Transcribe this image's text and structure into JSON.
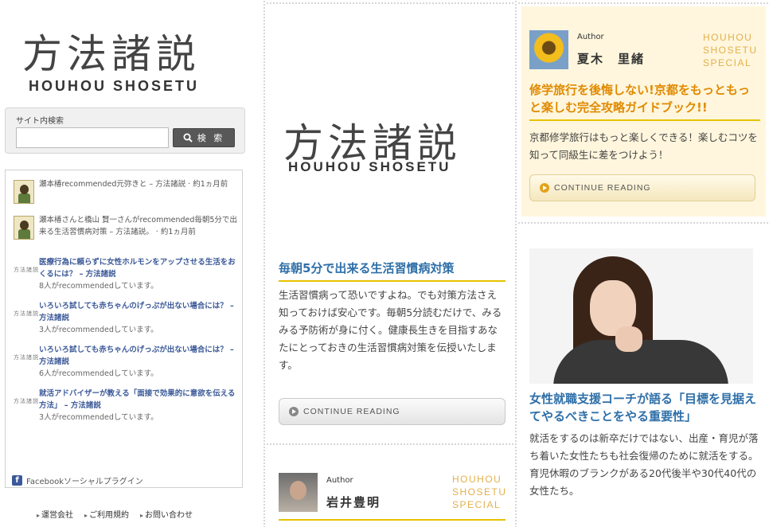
{
  "site": {
    "logo_jp": "方法諸説",
    "logo_en": "HOUHOU SHOSETU"
  },
  "search": {
    "label": "サイト内検索",
    "placeholder": "",
    "button_label": "検 索"
  },
  "facebook_plugin": {
    "items": [
      {
        "text": "瀬本椿recommended元弥きと – 方法諸説 · 約1ヵ月前",
        "meta": "",
        "thumb": "character"
      },
      {
        "text": "瀬本椿さんと橋山 賢一さんがrecommended毎朝5分で出来る生活習慣病対策 – 方法諸説。 · 約1ヵ月前",
        "meta": "",
        "thumb": "character"
      },
      {
        "text": "医療行為に頼らずに女性ホルモンをアップさせる生活をおくるには？ – 方法諸説",
        "meta": "8人がrecommendedしています。",
        "thumb": "logo"
      },
      {
        "text": "いろいろ試しても赤ちゃんのげっぷが出ない場合には？ – 方法諸説",
        "meta": "3人がrecommendedしています。",
        "thumb": "logo"
      },
      {
        "text": "いろいろ試しても赤ちゃんのげっぷが出ない場合には？ – 方法諸説",
        "meta": "6人がrecommendedしています。",
        "thumb": "logo"
      },
      {
        "text": "就活アドバイザーが教える「面接で効果的に意欲を伝える方法」 – 方法諸説",
        "meta": "3人がrecommendedしています。",
        "thumb": "logo"
      }
    ],
    "thumb_logo_text": "方法諸説",
    "footer_icon": "f",
    "footer_label": "Facebookソーシャルプラグイン"
  },
  "footer_links": [
    "運営会社",
    "ご利用規約",
    "お問い合わせ"
  ],
  "middle": {
    "article": {
      "title": "毎朝5分で出来る生活習慣病対策",
      "body": "生活習慣病って恐いですよね。でも対策方法さえ知っておけば安心です。毎朝5分読むだけで、みるみる予防術が身に付く。健康長生きを目指すあなたにとっておきの生活習慣病対策を伝授いたします。",
      "read_label": "CONTINUE READING"
    },
    "author": {
      "label": "Author",
      "name": "岩井豊明",
      "special_lines": [
        "HOUHOU",
        "SHOSETU",
        "SPECIAL"
      ]
    }
  },
  "right": {
    "author": {
      "label": "Author",
      "name": "夏木　里緒",
      "special_lines": [
        "HOUHOU",
        "SHOSETU",
        "SPECIAL"
      ]
    },
    "article": {
      "title": "修学旅行を後悔しない!京都をもっともっと楽しむ完全攻略ガイドブック!!",
      "body": "京都修学旅行はもっと楽しくできる！楽しむコツを知って同級生に差をつけよう！",
      "read_label": "CONTINUE READING"
    },
    "article2": {
      "title": "女性就職支援コーチが語る「目標を見据えてやるべきことをやる重要性」",
      "body": "就活をするのは新卒だけではない、出産・育児が落ち着いた女性たちも社会復帰のために就活をする。育児休暇のブランクがある20代後半や30代40代の女性たち。"
    }
  },
  "colors": {
    "accent_blue": "#2e6fa8",
    "accent_orange": "#e08a00",
    "accent_gold": "#e6c200",
    "special_tag": "#e3b04c",
    "highlight_bg": "#fff6dd",
    "facebook_blue": "#3b5998"
  },
  "icons": {
    "search_button": "search-icon",
    "read_button": "play-circle-icon",
    "footer_link": "triangle-bullet-icon"
  }
}
